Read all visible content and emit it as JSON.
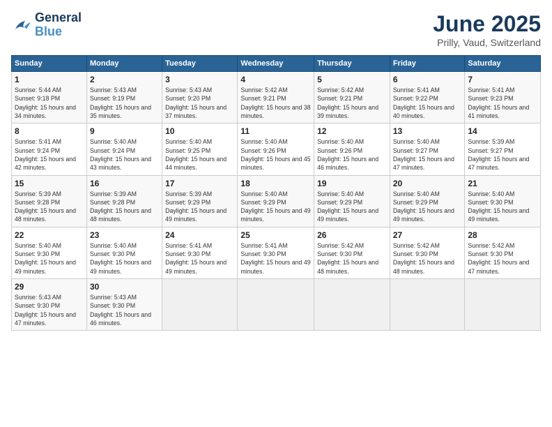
{
  "header": {
    "logo_line1": "General",
    "logo_line2": "Blue",
    "month": "June 2025",
    "location": "Prilly, Vaud, Switzerland"
  },
  "weekdays": [
    "Sunday",
    "Monday",
    "Tuesday",
    "Wednesday",
    "Thursday",
    "Friday",
    "Saturday"
  ],
  "weeks": [
    [
      {
        "day": 1,
        "sunrise": "5:44 AM",
        "sunset": "9:18 PM",
        "daylight": "15 hours and 34 minutes."
      },
      {
        "day": 2,
        "sunrise": "5:43 AM",
        "sunset": "9:19 PM",
        "daylight": "15 hours and 35 minutes."
      },
      {
        "day": 3,
        "sunrise": "5:43 AM",
        "sunset": "9:20 PM",
        "daylight": "15 hours and 37 minutes."
      },
      {
        "day": 4,
        "sunrise": "5:42 AM",
        "sunset": "9:21 PM",
        "daylight": "15 hours and 38 minutes."
      },
      {
        "day": 5,
        "sunrise": "5:42 AM",
        "sunset": "9:21 PM",
        "daylight": "15 hours and 39 minutes."
      },
      {
        "day": 6,
        "sunrise": "5:41 AM",
        "sunset": "9:22 PM",
        "daylight": "15 hours and 40 minutes."
      },
      {
        "day": 7,
        "sunrise": "5:41 AM",
        "sunset": "9:23 PM",
        "daylight": "15 hours and 41 minutes."
      }
    ],
    [
      {
        "day": 8,
        "sunrise": "5:41 AM",
        "sunset": "9:24 PM",
        "daylight": "15 hours and 42 minutes."
      },
      {
        "day": 9,
        "sunrise": "5:40 AM",
        "sunset": "9:24 PM",
        "daylight": "15 hours and 43 minutes."
      },
      {
        "day": 10,
        "sunrise": "5:40 AM",
        "sunset": "9:25 PM",
        "daylight": "15 hours and 44 minutes."
      },
      {
        "day": 11,
        "sunrise": "5:40 AM",
        "sunset": "9:26 PM",
        "daylight": "15 hours and 45 minutes."
      },
      {
        "day": 12,
        "sunrise": "5:40 AM",
        "sunset": "9:26 PM",
        "daylight": "15 hours and 46 minutes."
      },
      {
        "day": 13,
        "sunrise": "5:40 AM",
        "sunset": "9:27 PM",
        "daylight": "15 hours and 47 minutes."
      },
      {
        "day": 14,
        "sunrise": "5:39 AM",
        "sunset": "9:27 PM",
        "daylight": "15 hours and 47 minutes."
      }
    ],
    [
      {
        "day": 15,
        "sunrise": "5:39 AM",
        "sunset": "9:28 PM",
        "daylight": "15 hours and 48 minutes."
      },
      {
        "day": 16,
        "sunrise": "5:39 AM",
        "sunset": "9:28 PM",
        "daylight": "15 hours and 48 minutes."
      },
      {
        "day": 17,
        "sunrise": "5:39 AM",
        "sunset": "9:29 PM",
        "daylight": "15 hours and 49 minutes."
      },
      {
        "day": 18,
        "sunrise": "5:40 AM",
        "sunset": "9:29 PM",
        "daylight": "15 hours and 49 minutes."
      },
      {
        "day": 19,
        "sunrise": "5:40 AM",
        "sunset": "9:29 PM",
        "daylight": "15 hours and 49 minutes."
      },
      {
        "day": 20,
        "sunrise": "5:40 AM",
        "sunset": "9:29 PM",
        "daylight": "15 hours and 49 minutes."
      },
      {
        "day": 21,
        "sunrise": "5:40 AM",
        "sunset": "9:30 PM",
        "daylight": "15 hours and 49 minutes."
      }
    ],
    [
      {
        "day": 22,
        "sunrise": "5:40 AM",
        "sunset": "9:30 PM",
        "daylight": "15 hours and 49 minutes."
      },
      {
        "day": 23,
        "sunrise": "5:40 AM",
        "sunset": "9:30 PM",
        "daylight": "15 hours and 49 minutes."
      },
      {
        "day": 24,
        "sunrise": "5:41 AM",
        "sunset": "9:30 PM",
        "daylight": "15 hours and 49 minutes."
      },
      {
        "day": 25,
        "sunrise": "5:41 AM",
        "sunset": "9:30 PM",
        "daylight": "15 hours and 49 minutes."
      },
      {
        "day": 26,
        "sunrise": "5:42 AM",
        "sunset": "9:30 PM",
        "daylight": "15 hours and 48 minutes."
      },
      {
        "day": 27,
        "sunrise": "5:42 AM",
        "sunset": "9:30 PM",
        "daylight": "15 hours and 48 minutes."
      },
      {
        "day": 28,
        "sunrise": "5:42 AM",
        "sunset": "9:30 PM",
        "daylight": "15 hours and 47 minutes."
      }
    ],
    [
      {
        "day": 29,
        "sunrise": "5:43 AM",
        "sunset": "9:30 PM",
        "daylight": "15 hours and 47 minutes."
      },
      {
        "day": 30,
        "sunrise": "5:43 AM",
        "sunset": "9:30 PM",
        "daylight": "15 hours and 46 minutes."
      },
      null,
      null,
      null,
      null,
      null
    ]
  ]
}
